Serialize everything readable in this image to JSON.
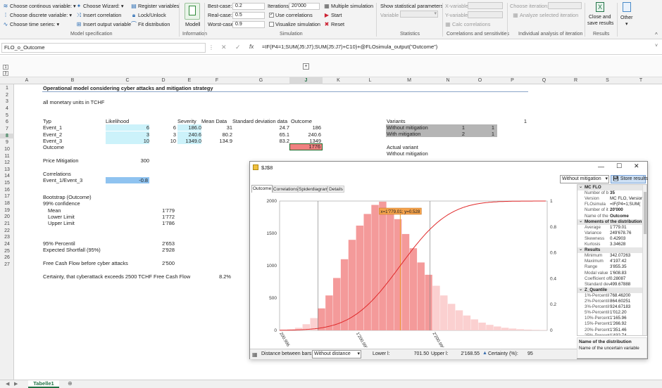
{
  "ribbon": {
    "model_spec": {
      "continuous": "Choose continous variable:",
      "discrete": "Choose discrete variable:",
      "time_series": "Choose time series:",
      "wizard": "Choose Wizard:",
      "insert_correlation": "Insert correlation",
      "insert_output": "Insert output variable",
      "register": "Register variables",
      "lock": "Lock/Unlock",
      "fit": "Fit distribution",
      "group": "Model specification"
    },
    "information": {
      "model": "Modell",
      "group": "Information"
    },
    "simulation": {
      "best_case_label": "Best-case:",
      "best_case": "0.2",
      "real_case_label": "Real-case:",
      "real_case": "0.5",
      "worst_case_label": "Worst-case:",
      "worst_case": "0.9",
      "iterations_label": "Iterations:",
      "iterations": "20'000",
      "use_corr": "Use correlations",
      "visualize": "Visualize simulation",
      "multiple": "Multiple simulation",
      "start": "Start",
      "reset": "Reset",
      "group": "Simulation"
    },
    "statistics": {
      "show": "Show statistical parameters",
      "variable": "Variable",
      "group": "Statistics"
    },
    "corr": {
      "xvar": "X-variable",
      "yvar": "Y-variable",
      "calc": "Calc correlations",
      "group": "Correlations and sensitivities"
    },
    "iteration": {
      "choose": "Choose iteration:",
      "analyze": "Analyze selected iteration",
      "group": "Individual analysis of iteration"
    },
    "results": {
      "close": "Close and",
      "save": "save results",
      "group": "Results"
    },
    "other": {
      "label": "Other"
    }
  },
  "formula_bar": {
    "name_box": "FLO_o_Outcome",
    "formula": "=IF(P4=1;SUM(J5:J7);SUM(J5:J7)+C10)+@FLOsimula_output(\"Outcome\")"
  },
  "columns": [
    "A",
    "B",
    "C",
    "D",
    "E",
    "F",
    "G",
    "H",
    "J",
    "K",
    "L",
    "M",
    "N",
    "O",
    "P",
    "Q",
    "R",
    "S",
    "T"
  ],
  "rows": [
    "1",
    "2",
    "3",
    "4",
    "5",
    "6",
    "7",
    "8",
    "9",
    "10",
    "11",
    "12",
    "13",
    "14",
    "15",
    "16",
    "17",
    "18",
    "19",
    "20",
    "21",
    "22",
    "23",
    "24",
    "25",
    "26",
    "27"
  ],
  "sheet": {
    "title": "Operational model considering cyber attacks and mitigation strategy",
    "subtitle": "all monetary units in TCHF",
    "h_typ": "Typ",
    "h_likelihood": "Likelihood",
    "h_severity": "Severity",
    "h_mean": "Mean Data",
    "h_sd": "Standard deviation data",
    "h_outcome": "Outcome",
    "events": [
      {
        "name": "Event_1",
        "likelihood": "6",
        "d": "6",
        "severity": "186.0",
        "mean": "31",
        "sd": "24.7",
        "outcome": "186"
      },
      {
        "name": "Event_2",
        "likelihood": "3",
        "d": "3",
        "severity": "240.6",
        "mean": "80.2",
        "sd": "65.1",
        "outcome": "240.6"
      },
      {
        "name": "Event_3",
        "likelihood": "10",
        "d": "10",
        "severity": "1349.0",
        "mean": "134.9",
        "sd": "83.2",
        "outcome": "1349"
      }
    ],
    "outcome_label": "Outcome",
    "outcome_value": "1776",
    "price_label": "Price Mitigation",
    "price_value": "300",
    "corr_label": "Correlations",
    "corr_name": "Event_1/Event_3",
    "corr_value": "-0.8",
    "bootstrap": "Bootstrap (Outcome)",
    "confidence": "99% confidence",
    "mean_label": "Mean",
    "mean_value": "1'779",
    "lower_label": "Lower Limit",
    "lower_value": "1'772",
    "upper_label": "Upper Limit",
    "upper_value": "1'786",
    "p95_label": "95% Percentil",
    "p95_value": "2'653",
    "es_label": "Expected Shortfall (95%)",
    "es_value": "2'928",
    "fcf_label": "Free Cash Flow before cyber attacks",
    "fcf_value": "2'500",
    "certainty_label": "Certainty, that cyberattack exceeds 2500 TCHF Free Cash Flow",
    "certainty_value": "8.2%",
    "variants_label": "Variants",
    "variants_value": "1",
    "v1": "Without mitigation",
    "v1a": "1",
    "v1b": "1",
    "v2": "With mitigation",
    "v2a": "2",
    "v2b": "1",
    "actual_label": "Actual variant",
    "actual_value": "Without mitigation"
  },
  "tab": "Tabelle1",
  "window": {
    "title": "$J$8",
    "dropdown": "Without mitigation",
    "store": "Store results",
    "tabs": [
      "Outcome",
      "Correlations",
      "Spiderdiagram",
      "Details"
    ],
    "bottom": {
      "dist_label": "Distance between bars:",
      "dist_value": "Without distance",
      "lower_label": "Lower l:",
      "lower_value": "701.50",
      "upper_label": "Upper l:",
      "upper_value": "2'168.55",
      "cert_label": "Certainty (%):",
      "cert_value": "95"
    },
    "tooltip": "x=1'779.01; y=0.528",
    "footer_title": "Name of the distribution",
    "footer_text": "Name of the uncertain variable",
    "panel": [
      {
        "h": "MC FLO"
      },
      {
        "k": "Number of b",
        "v": "35",
        "b": true
      },
      {
        "k": "Version",
        "v": "MC FLO, Version"
      },
      {
        "k": "FLOsimula",
        "v": "=IF(P4=1;SUM("
      },
      {
        "k": "Number of it",
        "v": "20'000",
        "b": true
      },
      {
        "k": "Name of the",
        "v": "Outcome",
        "b": true
      },
      {
        "h": "Moments of the distribution"
      },
      {
        "k": "Average",
        "v": "1'779.01"
      },
      {
        "k": "Variance",
        "v": "249'678.76"
      },
      {
        "k": "Skewness",
        "v": "0.42903"
      },
      {
        "k": "Kurtosis",
        "v": "3.34628"
      },
      {
        "h": "Results"
      },
      {
        "k": "Minimum",
        "v": "342.07263"
      },
      {
        "k": "Maximum",
        "v": "4'197.42"
      },
      {
        "k": "Range",
        "v": "3'855.35"
      },
      {
        "k": "Modal value",
        "v": "1'608.83"
      },
      {
        "k": "Coefficient of",
        "v": "0.28087"
      },
      {
        "k": "Standard dev",
        "v": "499.67888"
      },
      {
        "h": "Z_Quantile"
      },
      {
        "k": "1%-Percentil",
        "v": "768.46200"
      },
      {
        "k": "2%-Percentil",
        "v": "864.60251"
      },
      {
        "k": "3%-Percentil",
        "v": "924.67183"
      },
      {
        "k": "5%-Percentil",
        "v": "1'012.20"
      },
      {
        "k": "10%-Percentil",
        "v": "1'165.96"
      },
      {
        "k": "15%-Percentil",
        "v": "1'266.92"
      },
      {
        "k": "20%-Percentil",
        "v": "1'351.46"
      },
      {
        "k": "25%-Percentil",
        "v": "1'432.74"
      }
    ]
  },
  "chart_data": {
    "type": "bar",
    "x_ticks": [
      "200.996",
      "1'200.996",
      "2'200.996"
    ],
    "ylim": [
      0,
      2000
    ],
    "y_ticks": [
      "0",
      "500",
      "1000",
      "1500",
      "2000"
    ],
    "y2lim": [
      0,
      1
    ],
    "y2_ticks": [
      "0",
      "0.2",
      "0.4",
      "0.6",
      "0.8",
      "1"
    ],
    "xlim": [
      200.996,
      3700
    ],
    "bin_width": 100,
    "bins_start": 300.996,
    "values": [
      15,
      40,
      95,
      190,
      340,
      540,
      810,
      1100,
      1400,
      1620,
      1800,
      1940,
      1990,
      1890,
      1720,
      1490,
      1270,
      1050,
      860,
      690,
      540,
      410,
      310,
      230,
      170,
      120,
      85,
      60,
      40,
      28,
      18,
      12,
      8,
      5
    ],
    "lower_limit": 701.5,
    "upper_limit": 2168.55,
    "mean": 1779.01,
    "cumulative_mean": 1779.01,
    "cumulative_sd": 499.68,
    "colors": {
      "bar": "#f49a9a",
      "bar_outside": "#fbd0d0",
      "cdf": "#e0292a",
      "mean": "#f0a030",
      "tooltip": "#f5a34c"
    }
  }
}
